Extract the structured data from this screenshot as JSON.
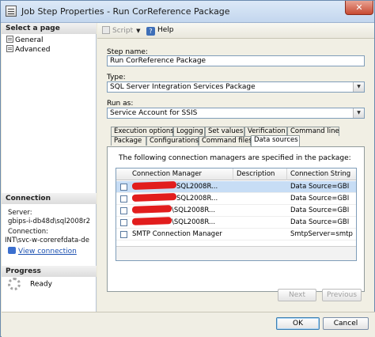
{
  "window": {
    "title": "Job Step Properties - Run CorReference Package",
    "close_glyph": "✕"
  },
  "left": {
    "select_page_header": "Select a page",
    "pages": [
      {
        "label": "General"
      },
      {
        "label": "Advanced"
      }
    ],
    "connection_header": "Connection",
    "server_label": "Server:",
    "server_value": "gbips-i-db48d\\sql2008r2",
    "connection_label": "Connection:",
    "connection_value": "INT\\svc-w-corerefdata-de",
    "view_connection": "View connection",
    "progress_header": "Progress",
    "progress_status": "Ready"
  },
  "toolbar": {
    "script_label": "Script",
    "help_label": "Help",
    "dropdown_glyph": "▼",
    "help_glyph": "?"
  },
  "form": {
    "step_name_label": "Step name:",
    "step_name_value": "Run CorReference Package",
    "type_label": "Type:",
    "type_value": "SQL Server Integration Services Package",
    "run_as_label": "Run as:",
    "run_as_value": "Service Account for SSIS",
    "combo_glyph": "▼"
  },
  "tabs_row1": [
    "Execution options",
    "Logging",
    "Set values",
    "Verification",
    "Command line"
  ],
  "tabs_row2": [
    "Package",
    "Configurations",
    "Command files",
    "Data sources"
  ],
  "active_tab": "Data sources",
  "panel": {
    "description": "The following connection managers are specified in the package:",
    "columns": [
      "Connection Manager",
      "Description",
      "Connection String"
    ],
    "rows": [
      {
        "manager_suffix": "SQL2008R...",
        "redacted": true,
        "description": "",
        "connection": "Data Source=GBI",
        "selected": true
      },
      {
        "manager_suffix": "SQL2008R...",
        "redacted": true,
        "description": "",
        "connection": "Data Source=GBI",
        "selected": false
      },
      {
        "manager_suffix": "\\SQL2008R...",
        "redacted": true,
        "description": "",
        "connection": "Data Source=GBI",
        "selected": false
      },
      {
        "manager_suffix": "\\SQL2008R...",
        "redacted": true,
        "description": "",
        "connection": "Data Source=GBI",
        "selected": false
      },
      {
        "manager_suffix": "SMTP Connection Manager",
        "redacted": false,
        "description": "",
        "connection": "SmtpServer=smtp",
        "selected": false
      }
    ],
    "next_label": "Next",
    "previous_label": "Previous"
  },
  "footer": {
    "ok_label": "OK",
    "cancel_label": "Cancel"
  }
}
